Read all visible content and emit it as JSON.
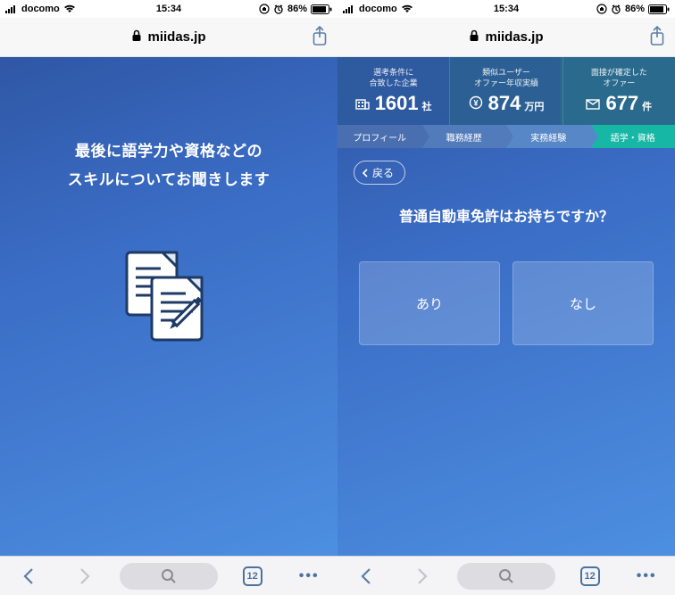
{
  "status": {
    "carrier": "docomo",
    "time": "15:34",
    "battery_pct": "86%"
  },
  "urlbar": {
    "domain": "miidas.jp"
  },
  "left_screen": {
    "intro_line1": "最後に語学力や資格などの",
    "intro_line2": "スキルについてお聞きします"
  },
  "right_screen": {
    "stats": [
      {
        "label_l1": "選考条件に",
        "label_l2": "合致した企業",
        "value": "1601",
        "unit": "社"
      },
      {
        "label_l1": "類似ユーザー",
        "label_l2": "オファー年収実績",
        "value": "874",
        "unit": "万円"
      },
      {
        "label_l1": "面接が確定した",
        "label_l2": "オファー",
        "value": "677",
        "unit": "件"
      }
    ],
    "steps": [
      "プロフィール",
      "職務経歴",
      "実務経験",
      "語学・資格"
    ],
    "back_label": "戻る",
    "question": "普通自動車免許はお持ちですか？",
    "choice_yes": "あり",
    "choice_no": "なし"
  },
  "toolbar": {
    "tab_count": "12"
  }
}
